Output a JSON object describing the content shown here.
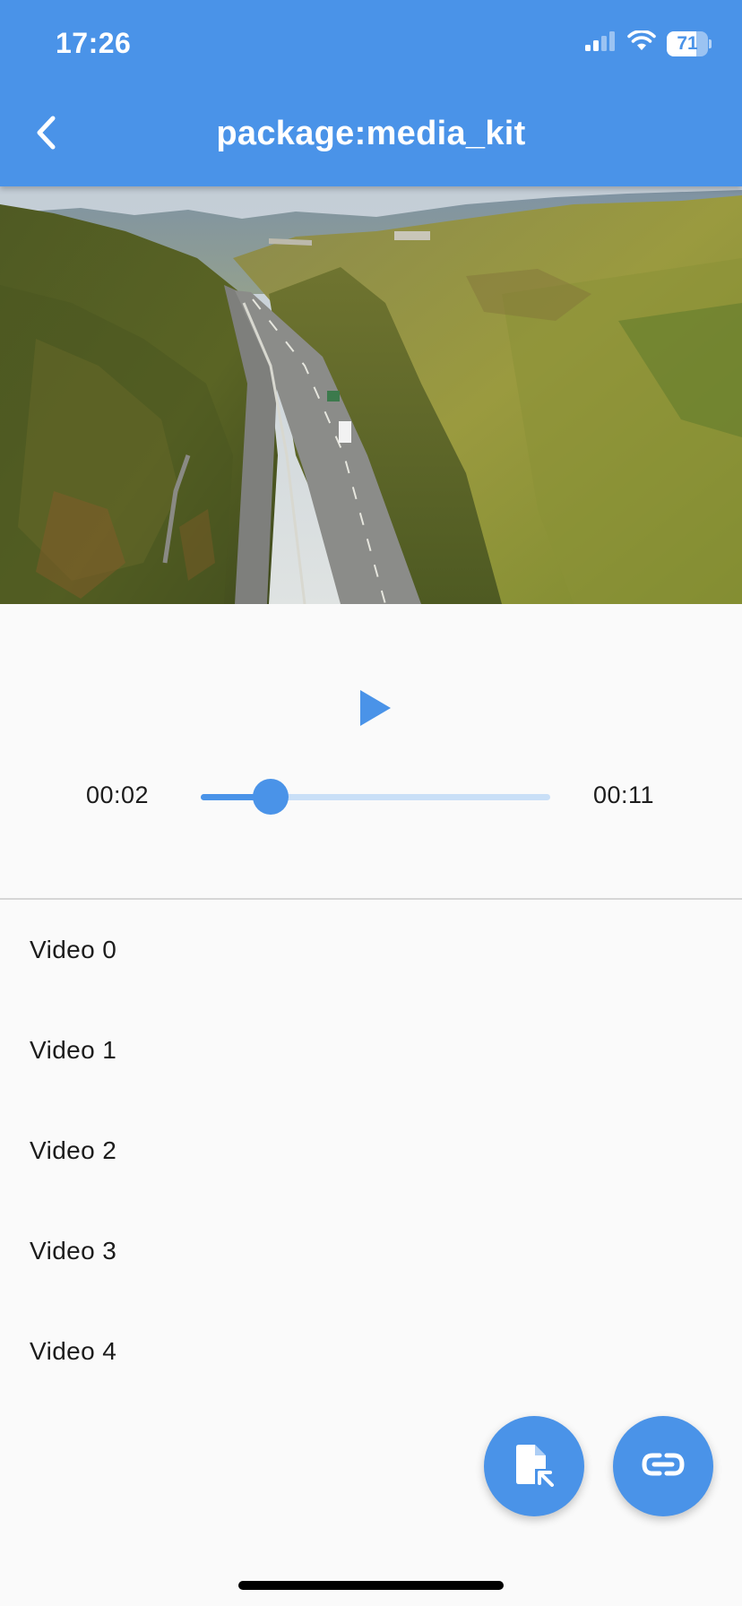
{
  "status_bar": {
    "time": "17:26",
    "battery_level": "71",
    "icons": [
      "cellular-signal-icon",
      "wifi-icon",
      "battery-icon"
    ]
  },
  "app_bar": {
    "title": "package:media_kit",
    "back_icon": "chevron-left-icon"
  },
  "player": {
    "play_icon": "play-icon",
    "position": "00:02",
    "duration": "00:11",
    "progress_fraction": 0.2
  },
  "video_list": [
    {
      "label": "Video 0"
    },
    {
      "label": "Video 1"
    },
    {
      "label": "Video 2"
    },
    {
      "label": "Video 3"
    },
    {
      "label": "Video 4"
    }
  ],
  "fabs": [
    {
      "icon": "file-open-icon"
    },
    {
      "icon": "link-icon"
    }
  ],
  "colors": {
    "primary": "#4a93e8",
    "slider_inactive": "#c9dff7",
    "background": "#fafafa",
    "text": "#1c1c1c"
  }
}
